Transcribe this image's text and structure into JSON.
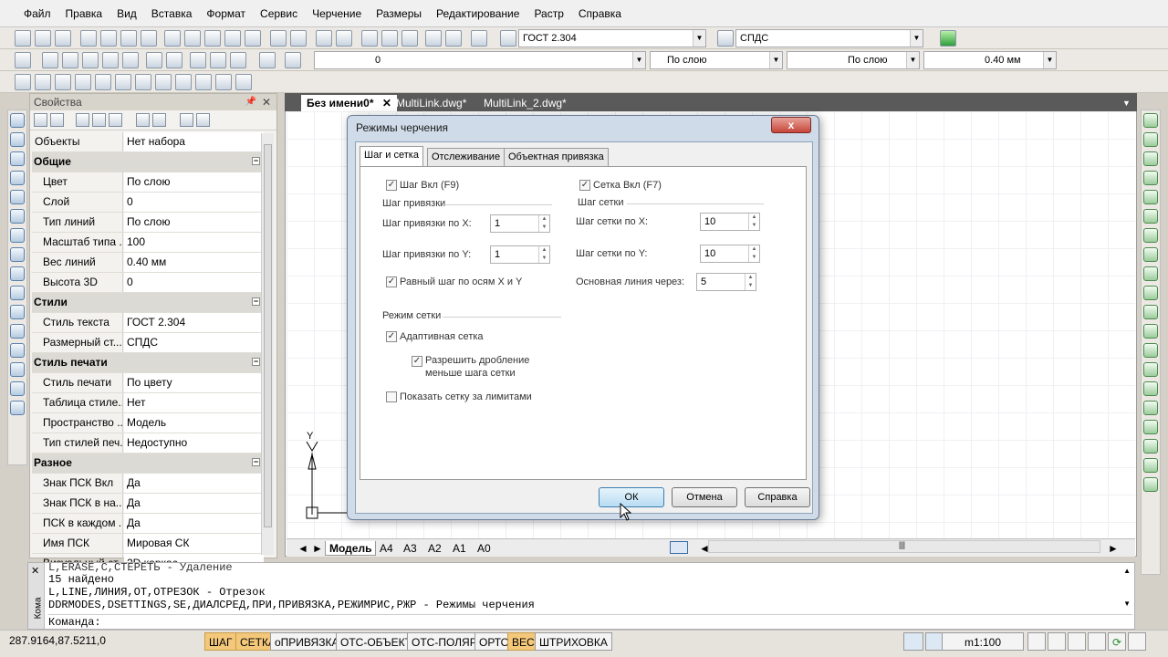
{
  "menu": [
    "Файл",
    "Правка",
    "Вид",
    "Вставка",
    "Формат",
    "Сервис",
    "Черчение",
    "Размеры",
    "Редактирование",
    "Растр",
    "Справка"
  ],
  "toolbar": {
    "text_style": "ГОСТ 2.304",
    "dim_style": "СПДС",
    "layer": "0",
    "color": "По слою",
    "linetype": "По слою",
    "lineweight": "0.40 мм"
  },
  "props": {
    "title": "Свойства",
    "objects_label": "Объекты",
    "objects_value": "Нет набора",
    "sections": [
      {
        "name": "Общие",
        "rows": [
          {
            "k": "Цвет",
            "v": "По слою"
          },
          {
            "k": "Слой",
            "v": "0"
          },
          {
            "k": "Тип линий",
            "v": "По слою"
          },
          {
            "k": "Масштаб типа ...",
            "v": "100"
          },
          {
            "k": "Вес линий",
            "v": "0.40 мм"
          },
          {
            "k": "Высота 3D",
            "v": "0"
          }
        ]
      },
      {
        "name": "Стили",
        "rows": [
          {
            "k": "Стиль текста",
            "v": "ГОСТ 2.304"
          },
          {
            "k": "Размерный ст...",
            "v": "СПДС"
          }
        ]
      },
      {
        "name": "Стиль печати",
        "rows": [
          {
            "k": "Стиль печати",
            "v": "По цвету"
          },
          {
            "k": "Таблица стиле...",
            "v": "Нет"
          },
          {
            "k": "Пространство ...",
            "v": "Модель"
          },
          {
            "k": "Тип стилей печ...",
            "v": "Недоступно"
          }
        ]
      },
      {
        "name": "Разное",
        "rows": [
          {
            "k": "Знак ПСК Вкл",
            "v": "Да"
          },
          {
            "k": "Знак ПСК в на...",
            "v": "Да"
          },
          {
            "k": "ПСК в каждом ...",
            "v": "Да"
          },
          {
            "k": "Имя ПСК",
            "v": "Мировая СК"
          },
          {
            "k": "Визуальный ст...",
            "v": "2D каркас"
          }
        ]
      }
    ]
  },
  "doc_tabs": [
    "Без имени0*",
    "MultiLink.dwg*",
    "MultiLink_2.dwg*"
  ],
  "model_tabs": [
    "Модель",
    "A4",
    "A3",
    "A2",
    "A1",
    "A0"
  ],
  "axis_y": "Y",
  "dialog": {
    "title": "Режимы черчения",
    "close": "x",
    "tabs": [
      "Шаг и сетка",
      "Отслеживание",
      "Объектная привязка"
    ],
    "snap_on": "Шаг Вкл (F9)",
    "snap_group": "Шаг привязки",
    "snap_x_label": "Шаг привязки по X:",
    "snap_x": "1",
    "snap_y_label": "Шаг привязки по Y:",
    "snap_y": "1",
    "equal_step": "Равный шаг по осям X и Y",
    "grid_on": "Сетка Вкл (F7)",
    "grid_group": "Шаг сетки",
    "grid_x_label": "Шаг сетки по X:",
    "grid_x": "10",
    "grid_y_label": "Шаг сетки по Y:",
    "grid_y": "10",
    "major_label": "Основная линия через:",
    "major": "5",
    "grid_mode": "Режим сетки",
    "adaptive": "Адаптивная сетка",
    "subdivide_1": "Разрешить дробление",
    "subdivide_2": "меньше шага сетки",
    "beyond_limits": "Показать сетку за лимитами",
    "ok": "ОК",
    "cancel": "Отмена",
    "help": "Справка"
  },
  "command": {
    "side_label": "Кома",
    "lines": [
      "L,ERASE,С,СТЕРЕТЬ - Удаление",
      "15 найдено",
      "L,LINE,ЛИНИЯ,ОТ,ОТРЕЗОК - Отрезок",
      "DDRMODES,DSETTINGS,SE,ДИАЛСРЕД,ПРИ,ПРИВЯЗКА,РЕЖИМРИС,РЖР - Режимы черчения"
    ],
    "prompt": "Команда:"
  },
  "status": {
    "coords": "287.9164,87.5211,0",
    "modes": [
      {
        "label": "ШАГ",
        "on": true
      },
      {
        "label": "СЕТКА",
        "on": true
      },
      {
        "label": "оПРИВЯЗКА",
        "on": false
      },
      {
        "label": "ОТС-ОБЪЕКТ",
        "on": false
      },
      {
        "label": "ОТС-ПОЛЯР",
        "on": false
      },
      {
        "label": "ОРТО",
        "on": false
      },
      {
        "label": "ВЕС",
        "on": true
      },
      {
        "label": "ШТРИХОВКА",
        "on": false
      }
    ],
    "scale": "m1:100"
  }
}
